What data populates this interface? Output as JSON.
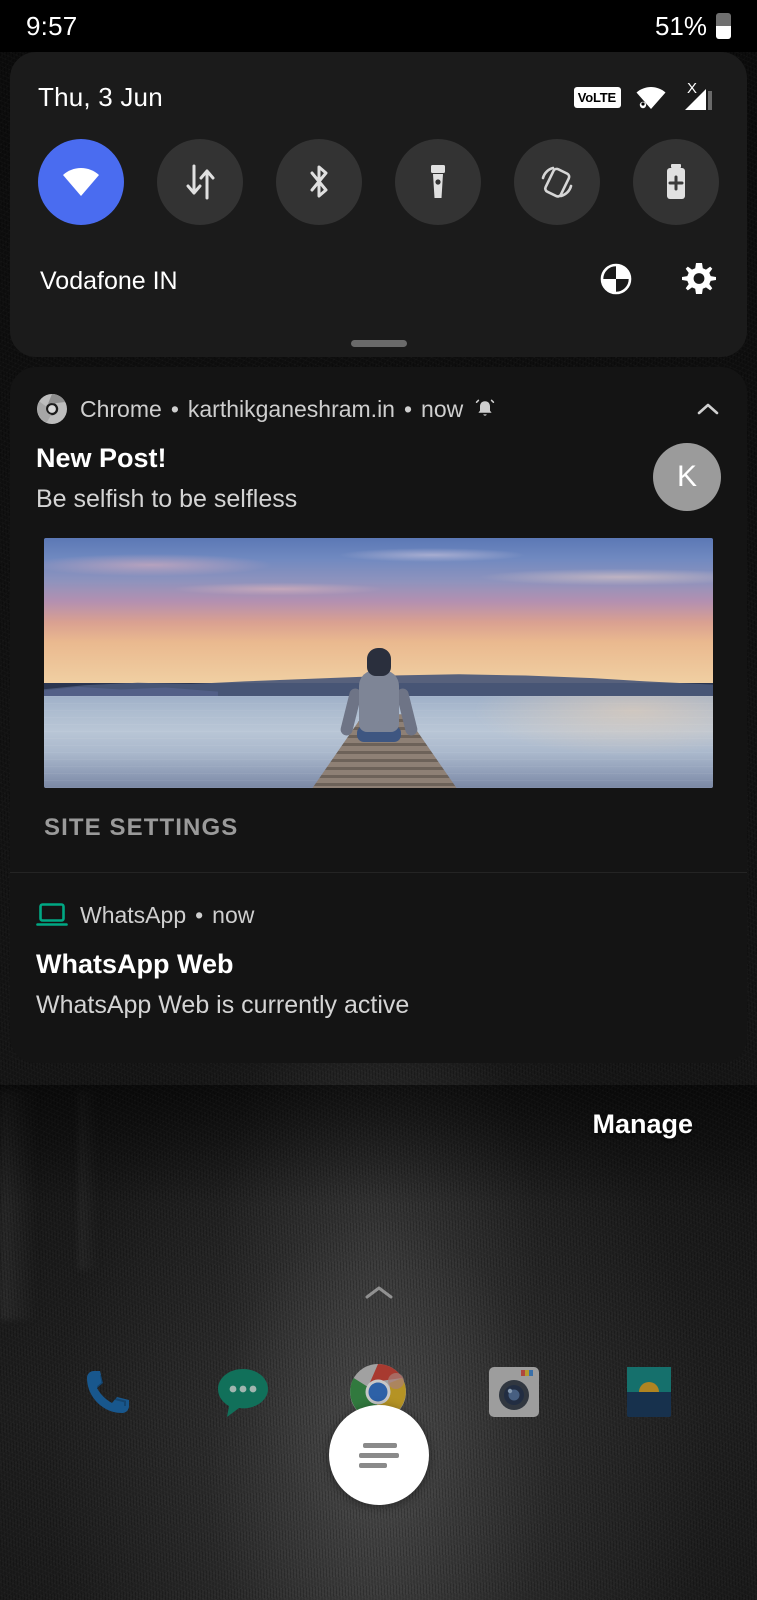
{
  "status_bar": {
    "clock": "9:57",
    "battery_percent": "51%",
    "battery_icon": "battery-icon"
  },
  "quick_settings": {
    "date": "Thu, 3 Jun",
    "status_icons": {
      "volte_label": "VoLTE",
      "wifi_icon": "wifi-icon",
      "signal_icon": "signal-bars-icon",
      "signal_badge": "X"
    },
    "tiles": [
      {
        "name": "wifi",
        "label": "Wi-Fi",
        "active": true,
        "icon": "wifi-icon"
      },
      {
        "name": "mobile-data",
        "label": "Mobile data",
        "active": false,
        "icon": "data-arrows-icon"
      },
      {
        "name": "bluetooth",
        "label": "Bluetooth",
        "active": false,
        "icon": "bluetooth-icon"
      },
      {
        "name": "flashlight",
        "label": "Flashlight",
        "active": false,
        "icon": "flashlight-icon"
      },
      {
        "name": "auto-rotate",
        "label": "Auto-rotate",
        "active": false,
        "icon": "auto-rotate-icon"
      },
      {
        "name": "battery-saver",
        "label": "Battery Saver",
        "active": false,
        "icon": "battery-saver-icon"
      }
    ],
    "carrier": "Vodafone IN",
    "footer_icons": [
      {
        "name": "power-menu",
        "icon": "power-circle-icon"
      },
      {
        "name": "settings",
        "icon": "gear-icon"
      }
    ],
    "accent_color": "#4a6cf0",
    "panel_color": "#1b1b1b"
  },
  "notifications": [
    {
      "app": "Chrome",
      "app_icon": "chrome-icon",
      "source": "karthikganeshram.in",
      "time": "now",
      "alert_icon": "bell-icon",
      "collapse_icon": "chevron-up-icon",
      "title": "New Post!",
      "body": "Be selfish to be selfless",
      "avatar_letter": "K",
      "avatar_color": "#9b9b9b",
      "has_picture": true,
      "picture_alt": "Person sitting on a wooden dock at a lake during sunset",
      "actions": [
        "SITE SETTINGS"
      ]
    },
    {
      "app": "WhatsApp",
      "app_icon": "laptop-icon",
      "app_icon_color": "#00a884",
      "time": "now",
      "title": "WhatsApp Web",
      "body": "WhatsApp Web is currently active",
      "has_picture": false,
      "actions": []
    }
  ],
  "manage": {
    "label": "Manage"
  },
  "home": {
    "drawer_indicator": "chevron-up-icon",
    "dock_apps": [
      {
        "name": "phone",
        "label": "Phone",
        "icon": "phone-icon"
      },
      {
        "name": "messages",
        "label": "Messages",
        "icon": "message-bubble-icon"
      },
      {
        "name": "chrome",
        "label": "Chrome",
        "icon": "chrome-icon"
      },
      {
        "name": "camera",
        "label": "Camera",
        "icon": "camera-icon"
      },
      {
        "name": "gallery",
        "label": "Gallery",
        "icon": "gallery-icon"
      }
    ],
    "fab": {
      "name": "assistant-button",
      "icon": "text-lines-icon"
    }
  }
}
